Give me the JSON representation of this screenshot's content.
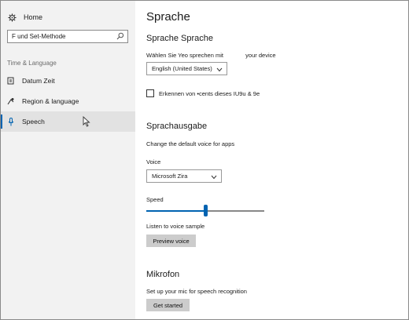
{
  "sidebar": {
    "home_label": "Home",
    "search_value": "F und Set-Methode",
    "section_label": "Time & Language",
    "items": [
      {
        "label": "Datum  Zeit"
      },
      {
        "label": "Region & language"
      },
      {
        "label": "Speech"
      }
    ]
  },
  "main": {
    "title": "Sprache",
    "speech_language": {
      "heading": "Sprache Sprache",
      "desc_part1": "Wählen Sie Yeo sprechen mit",
      "desc_part2": "your device",
      "dropdown_value": "English (United States)",
      "checkbox_label": "Erkennen von •cents dieses IU9u & 9e"
    },
    "text_to_speech": {
      "heading": "Sprachausgabe",
      "desc": "Change the default voice for apps",
      "voice_label": "Voice",
      "voice_value": "Microsoft Zira",
      "speed_label": "Speed",
      "speed_fraction": 0.5,
      "sample_label": "Listen to voice sample",
      "preview_button": "Preview voice"
    },
    "microphone": {
      "heading": "Mikrofon",
      "desc": "Set up your mic for speech recognition",
      "button": "Get started"
    }
  },
  "colors": {
    "accent": "#0063b1",
    "sidebar_bg": "#f2f2f2",
    "active_bg": "#e2e2e2",
    "button_bg": "#cccccc"
  },
  "icons": {
    "home": "gear-icon",
    "search": "search-icon",
    "date_time": "clock-icon",
    "region": "region-language-icon",
    "speech": "microphone-icon",
    "cursor": "mouse-pointer-icon"
  }
}
